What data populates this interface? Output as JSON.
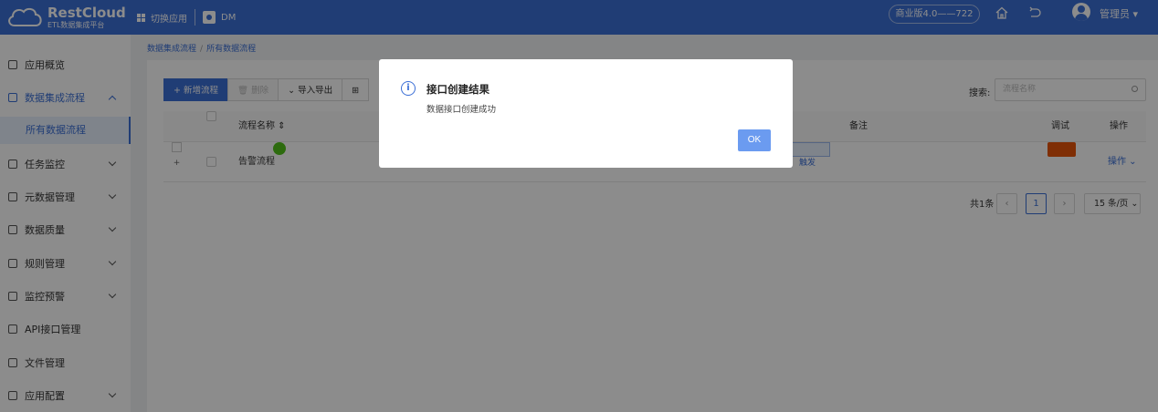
{
  "header": {
    "logo_name": "RestCloud",
    "logo_sub": "ETL数据集成平台",
    "switch_app": "切换应用",
    "app_code": "DM",
    "version": "商业版4.0——722",
    "user": "管理员"
  },
  "sidebar": {
    "items": [
      {
        "label": "应用概览"
      },
      {
        "label": "数据集成流程"
      },
      {
        "label": "任务监控"
      },
      {
        "label": "元数据管理"
      },
      {
        "label": "数据质量"
      },
      {
        "label": "规则管理"
      },
      {
        "label": "监控预警"
      },
      {
        "label": "API接口管理"
      },
      {
        "label": "文件管理"
      },
      {
        "label": "应用配置"
      }
    ],
    "sub_active": "所有数据流程"
  },
  "breadcrumb": [
    "数据集成流程",
    "所有数据流程"
  ],
  "toolbar": {
    "add": "+ 新增流程",
    "delete": "删除",
    "import_export": "导入导出"
  },
  "search": {
    "label": "搜索:",
    "placeholder": "流程名称"
  },
  "table": {
    "columns": {
      "name": "流程名称",
      "remark": "备注",
      "debug": "调试",
      "action": "操作"
    },
    "rows": [
      {
        "name": "告警流程",
        "badge": "1",
        "tag": "触发",
        "debug": "调试",
        "action": "操作"
      }
    ]
  },
  "pagination": {
    "total": "共1条",
    "current": "1",
    "page_size": "15 条/页"
  },
  "modal": {
    "title": "接口创建结果",
    "message": "数据接口创建成功",
    "ok": "OK"
  }
}
